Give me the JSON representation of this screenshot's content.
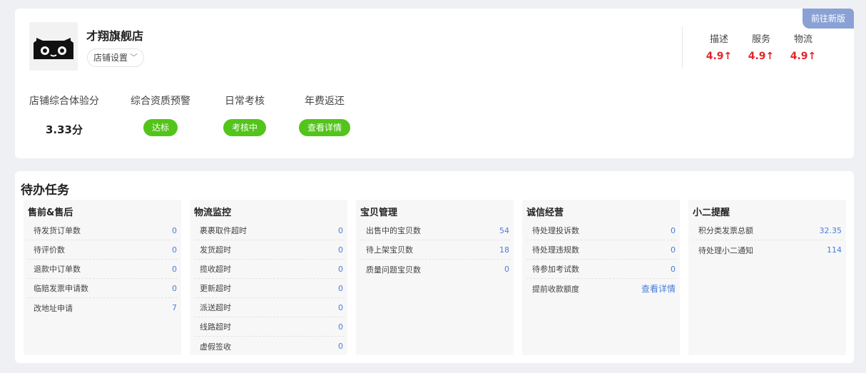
{
  "shop": {
    "name": "才翔旗舰店",
    "settings_label": "店铺设置",
    "new_version_label": "前往新版"
  },
  "ratings": [
    {
      "label": "描述",
      "value": "4.9↑"
    },
    {
      "label": "服务",
      "value": "4.9↑"
    },
    {
      "label": "物流",
      "value": "4.9↑"
    }
  ],
  "metrics": {
    "experience": {
      "label": "店铺综合体验分",
      "value": "3.33分"
    },
    "qualification": {
      "label": "综合资质预警",
      "status": "达标"
    },
    "daily": {
      "label": "日常考核",
      "status": "考核中"
    },
    "annual_fee": {
      "label": "年费返还",
      "status": "查看详情"
    }
  },
  "colors": {
    "accent_green": "#52c41a",
    "rating_red": "#e4262b",
    "link_blue": "#4a7ed6",
    "header_underline": "#f6a623",
    "new_version_bg": "#8aa1d6"
  },
  "tasks": {
    "title": "待办任务",
    "columns": [
      {
        "title": "售前&售后",
        "rows": [
          {
            "label": "待发货订单数",
            "value": "0"
          },
          {
            "label": "待评价数",
            "value": "0"
          },
          {
            "label": "退款中订单数",
            "value": "0"
          },
          {
            "label": "临赔发票申请数",
            "value": "0"
          },
          {
            "label": "改地址申请",
            "value": "7"
          }
        ]
      },
      {
        "title": "物流监控",
        "rows": [
          {
            "label": "裹裹取件超时",
            "value": "0"
          },
          {
            "label": "发货超时",
            "value": "0"
          },
          {
            "label": "揽收超时",
            "value": "0"
          },
          {
            "label": "更新超时",
            "value": "0"
          },
          {
            "label": "派送超时",
            "value": "0"
          },
          {
            "label": "线路超时",
            "value": "0"
          },
          {
            "label": "虚假签收",
            "value": "0"
          }
        ]
      },
      {
        "title": "宝贝管理",
        "rows": [
          {
            "label": "出售中的宝贝数",
            "value": "54"
          },
          {
            "label": "待上架宝贝数",
            "value": "18"
          },
          {
            "label": "质量问题宝贝数",
            "value": "0"
          }
        ]
      },
      {
        "title": "诚信经营",
        "rows": [
          {
            "label": "待处理投诉数",
            "value": "0"
          },
          {
            "label": "待处理违规数",
            "value": "0"
          },
          {
            "label": "待参加考试数",
            "value": "0"
          },
          {
            "label": "提前收款额度",
            "value": "查看详情"
          }
        ]
      },
      {
        "title": "小二提醒",
        "rows": [
          {
            "label": "积分类发票总额",
            "value": "32.35"
          },
          {
            "label": "待处理小二通知",
            "value": "114"
          }
        ]
      }
    ]
  }
}
